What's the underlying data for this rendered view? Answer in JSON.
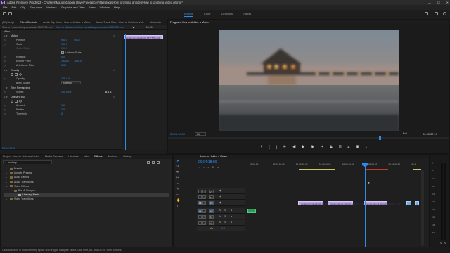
{
  "window": {
    "title": "Adobe Premiere Pro 2022 - C:\\Users\\Mauori\\Google Drive\\Freelance\\Fiftergrode\\How to Unblur a Video\\How to Unblur a Video.prproj *",
    "app_icon_label": "Pr",
    "controls": [
      "—",
      "☐",
      "✕"
    ]
  },
  "menu": [
    "File",
    "Edit",
    "Clip",
    "Sequence",
    "Markers",
    "Graphics and Titles",
    "View",
    "Window",
    "Help"
  ],
  "workspaces": {
    "items": [
      "Editing",
      "Color",
      "Graphics",
      "Effects"
    ],
    "active": "Editing"
  },
  "source_panel": {
    "tabs": [
      "(LD)Script",
      "Effect Controls",
      "Audio Clip Mixer: How to Unblur a Video",
      "Audio Track Mixer: How to Unblur a Vide",
      "Metadata"
    ],
    "active_tab": "Effect Controls",
    "source_label": "Source • pexels-lasyna-ashash-9837571-mp4",
    "sequence_label": "How to Unblur a Video • pexels-lasyna-ashash-9837571.mp4",
    "clip_timecode": "00:00",
    "clip_end_timecode": "00:04",
    "clip_name": "pexels-lasyna-ashash-9837571.mp4"
  },
  "effect_controls": {
    "video_header": "Video",
    "sections": [
      {
        "name": "Motion",
        "props": [
          {
            "label": "Position",
            "values": [
              "960.0",
              "540.0"
            ]
          },
          {
            "label": "Scale",
            "values": [
              "100.0"
            ]
          },
          {
            "label": "Scale Width",
            "values": [
              "100.0"
            ],
            "disabled": true
          },
          {
            "label": "",
            "checkbox": "Uniform Scale"
          },
          {
            "label": "Rotation",
            "values": [
              "0.0"
            ]
          },
          {
            "label": "Anchor Point",
            "values": [
              "1920.0",
              "1080.0"
            ]
          },
          {
            "label": "Anti-flicker Filter",
            "values": [
              "0.00"
            ]
          }
        ]
      },
      {
        "name": "Opacity",
        "props": [
          {
            "label": "Opacity",
            "values": [
              "100.0 %"
            ]
          },
          {
            "label": "Blend Mode",
            "dropdown": "Normal"
          }
        ]
      },
      {
        "name": "Time Remapping",
        "props": [
          {
            "label": "Speed",
            "values": [
              "100.00%"
            ]
          }
        ]
      },
      {
        "name": "Unsharp Blur",
        "props": [
          {
            "label": "Amount",
            "values": [
              "150"
            ]
          },
          {
            "label": "Radius",
            "values": [
              "1.0"
            ]
          },
          {
            "label": "Threshold",
            "values": [
              "0"
            ]
          }
        ]
      }
    ],
    "timecode": "00:04:18:00"
  },
  "program_monitor": {
    "title": "Program: How to Unblur a Video",
    "timecode": "00:04:18:00",
    "fit": "Fit",
    "quality": "Full",
    "duration": "00:00:37:17"
  },
  "project_panel": {
    "tabs": [
      "Project: How to Unblur a Video",
      "Media Browser",
      "Libraries",
      "Info",
      "Effects",
      "Markers",
      "History"
    ],
    "active_tab": "Effects",
    "search_value": "unsharp",
    "tree": [
      {
        "label": "Presets",
        "depth": 0
      },
      {
        "label": "Lumetri Presets",
        "depth": 0
      },
      {
        "label": "Audio Effects",
        "depth": 0
      },
      {
        "label": "Audio Transitions",
        "depth": 0
      },
      {
        "label": "Video Effects",
        "depth": 0,
        "open": true
      },
      {
        "label": "Blur & Sharpen",
        "depth": 1,
        "open": true
      },
      {
        "label": "Unsharp Mask",
        "depth": 2,
        "selected": true
      },
      {
        "label": "Video Transitions",
        "depth": 0
      }
    ]
  },
  "timeline": {
    "title": "How to Unblur a Video",
    "timecode": "00:04:18:00",
    "ruler": [
      "00:00:00",
      "00:01:00:00",
      "00:02:00:00",
      "00:03:00:00",
      "00:04:00:00",
      "00:05:00:00",
      "00:06:00:00",
      "00:0"
    ],
    "video_tracks": [
      "V3",
      "V2",
      "V1"
    ],
    "audio_tracks": [
      "A1",
      "A2",
      "A3"
    ],
    "mix_label": "Mix",
    "mix_value": "0.0",
    "source_patch": [
      "V1",
      "A1"
    ],
    "track_icons": {
      "sync": "S",
      "mute": "M"
    },
    "clips": [
      {
        "label": "pexels-lasyna-ashash-9837571.mp4"
      },
      {
        "label": "pexels-lasyna-ashash-9837571.mp4"
      },
      {
        "label": "pexels-lasyna-ashash-9837571.mp4"
      }
    ]
  },
  "audio_meter": {
    "labels": [
      "0",
      "-6",
      "-12",
      "-18",
      "-24",
      "-30",
      "-36",
      "-42",
      "-48",
      "-54"
    ],
    "solo": "S"
  },
  "status_bar": {
    "text": "Click to select, or click in empty space and drag to marquee select. Use Shift, Alt, and Ctrl for other options."
  },
  "colors": {
    "accent": "#2d8ceb",
    "clip": "#b9a3e0",
    "audio": "#2e9b5a",
    "playhead": "#2d8ceb"
  }
}
